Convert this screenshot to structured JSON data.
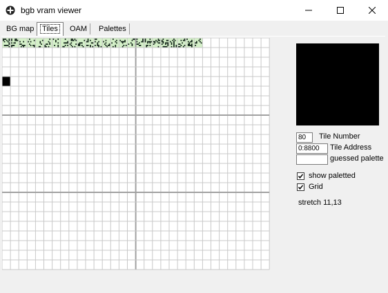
{
  "window": {
    "title": "bgb vram viewer"
  },
  "tabs": [
    {
      "label": "BG map",
      "active": false
    },
    {
      "label": "Tiles",
      "active": true
    },
    {
      "label": "OAM",
      "active": false
    },
    {
      "label": "Palettes",
      "active": false
    }
  ],
  "tile_info": {
    "tile_number_value": "80",
    "tile_number_label": "Tile Number",
    "tile_address_value": "0:8800",
    "tile_address_label": "Tile Address",
    "guessed_palette_value": "",
    "guessed_palette_label": "guessed palette"
  },
  "options": {
    "show_paletted_label": "show paletted",
    "show_paletted_checked": true,
    "grid_label": "Grid",
    "grid_checked": true
  },
  "status": {
    "stretch_text": "stretch 11,13"
  },
  "colors": {
    "grid_line": "#c8c8c8",
    "grid_major": "#a0a0a0",
    "tile_background": "#ffffff",
    "tile_highlight": "#d4f0c8",
    "tile_pixel": "#0a1a12",
    "preview_bg": "#000000"
  },
  "tile_grid": {
    "columns": 32,
    "rows": 24,
    "highlighted_tiles": 24,
    "selected_tile_index": 128
  }
}
